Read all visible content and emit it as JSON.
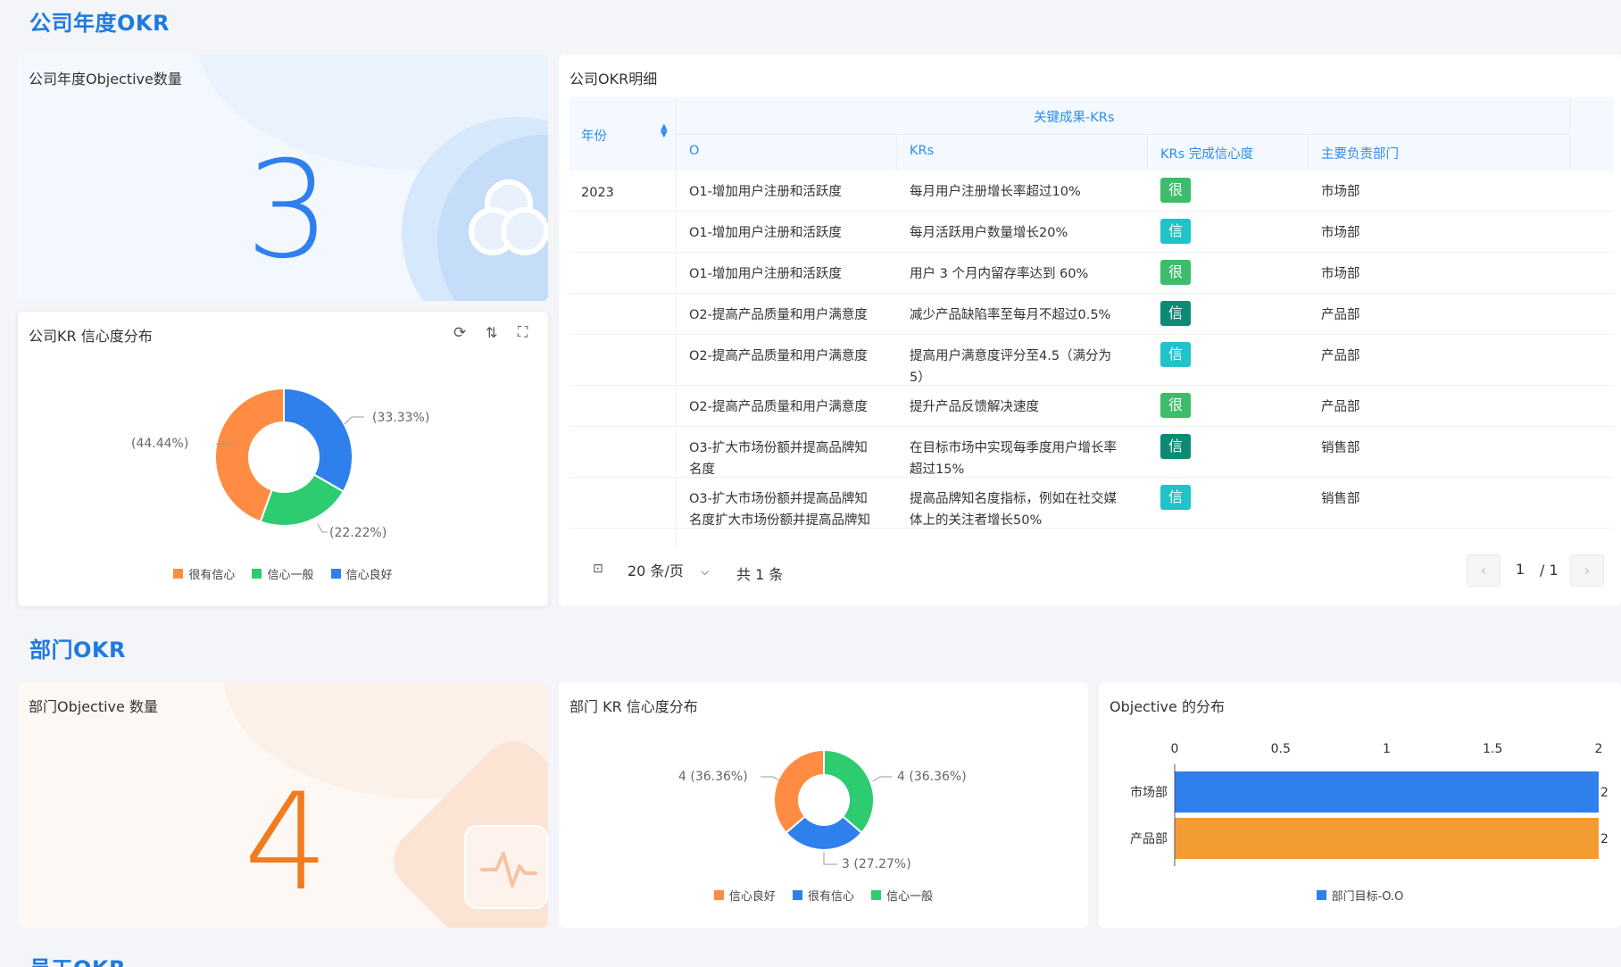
{
  "sections": {
    "company": "公司年度OKR",
    "dept": "部门OKR",
    "staff": "员工OKR"
  },
  "company_obj": {
    "title": "公司年度Objective数量",
    "value": "3"
  },
  "company_kr": {
    "title": "公司KR 信心度分布",
    "labels": {
      "a": "(44.44%)",
      "b": "(33.33%)",
      "c": "(22.22%)"
    },
    "legend": [
      "很有信心",
      "信心一般",
      "信心良好"
    ],
    "colors": {
      "orange": "#ff8c42",
      "green": "#2ecc71",
      "blue": "#2f80ed"
    }
  },
  "okr_detail": {
    "title": "公司OKR明细",
    "headers": {
      "year": "年份",
      "group": "关键成果-KRs",
      "o": "O",
      "krs": "KRs",
      "conf": "KRs 完成信心度",
      "dept": "主要负责部门"
    },
    "year": "2023",
    "rows": [
      {
        "o": "O1-增加用户注册和活跃度",
        "kr": "每月用户注册增长率超过10%",
        "conf": "很有信心",
        "dept": "市场部"
      },
      {
        "o": "O1-增加用户注册和活跃度",
        "kr": "每月活跃用户数量增长20%",
        "conf": "信心良好",
        "dept": "市场部"
      },
      {
        "o": "O1-增加用户注册和活跃度",
        "kr": "用户 3 个月内留存率达到 60%",
        "conf": "很有信心",
        "dept": "市场部"
      },
      {
        "o": "O2-提高产品质量和用户满意度",
        "kr": "减少产品缺陷率至每月不超过0.5%",
        "conf": "信心一般",
        "dept": "产品部"
      },
      {
        "o": "O2-提高产品质量和用户满意度",
        "kr": "提高用户满意度评分至4.5（满分为",
        "kr2": "5）",
        "conf": "信心良好",
        "dept": "产品部"
      },
      {
        "o": "O2-提高产品质量和用户满意度",
        "kr": "提升产品反馈解决速度",
        "conf": "很有信心",
        "dept": "产品部"
      },
      {
        "o": "O3-扩大市场份额并提高品牌知",
        "o2": "名度",
        "kr": "在目标市场中实现每季度用户增长率",
        "kr2": "超过15%",
        "conf": "信心一般",
        "dept": "销售部"
      },
      {
        "o": "O3-扩大市场份额并提高品牌知",
        "o2": "名度扩大市场份额并提高品牌知",
        "kr": "提高品牌知名度指标，例如在社交媒",
        "kr2": "体上的关注者增长50%",
        "conf": "信心良好",
        "dept": "销售部"
      }
    ],
    "tag_colors": {
      "很有信心": "#3dbd6b",
      "信心良好": "#1fc3c9",
      "信心一般": "#0d8a73"
    },
    "pager": {
      "size": "20 条/页",
      "total": "共 1 条",
      "page": "1",
      "pages": "/ 1",
      "prev": "‹",
      "next": "›"
    }
  },
  "dept_obj": {
    "title": "部门Objective 数量",
    "value": "4"
  },
  "dept_kr": {
    "title": "部门 KR 信心度分布",
    "labels": {
      "a": "4 (36.36%)",
      "b": "4 (36.36%)",
      "c": "3 (27.27%)"
    },
    "legend": [
      "信心良好",
      "很有信心",
      "信心一般"
    ]
  },
  "obj_dist": {
    "title": "Objective 的分布",
    "legend": "部门目标-O.O"
  },
  "chart_data": [
    {
      "type": "pie",
      "title": "公司KR 信心度分布",
      "categories": [
        "很有信心",
        "信心良好",
        "信心一般"
      ],
      "values": [
        44.44,
        33.33,
        22.22
      ]
    },
    {
      "type": "pie",
      "title": "部门 KR 信心度分布",
      "categories": [
        "信心良好",
        "信心一般",
        "很有信心"
      ],
      "values": [
        4,
        4,
        3
      ]
    },
    {
      "type": "bar",
      "title": "Objective 的分布",
      "categories": [
        "市场部",
        "产品部"
      ],
      "values": [
        2,
        2
      ],
      "ticks": [
        "0",
        "0.5",
        "1",
        "1.5",
        "2"
      ],
      "xlim": [
        0,
        2
      ],
      "series": [
        {
          "name": "部门目标-O.O",
          "values": [
            2,
            2
          ]
        }
      ]
    }
  ]
}
